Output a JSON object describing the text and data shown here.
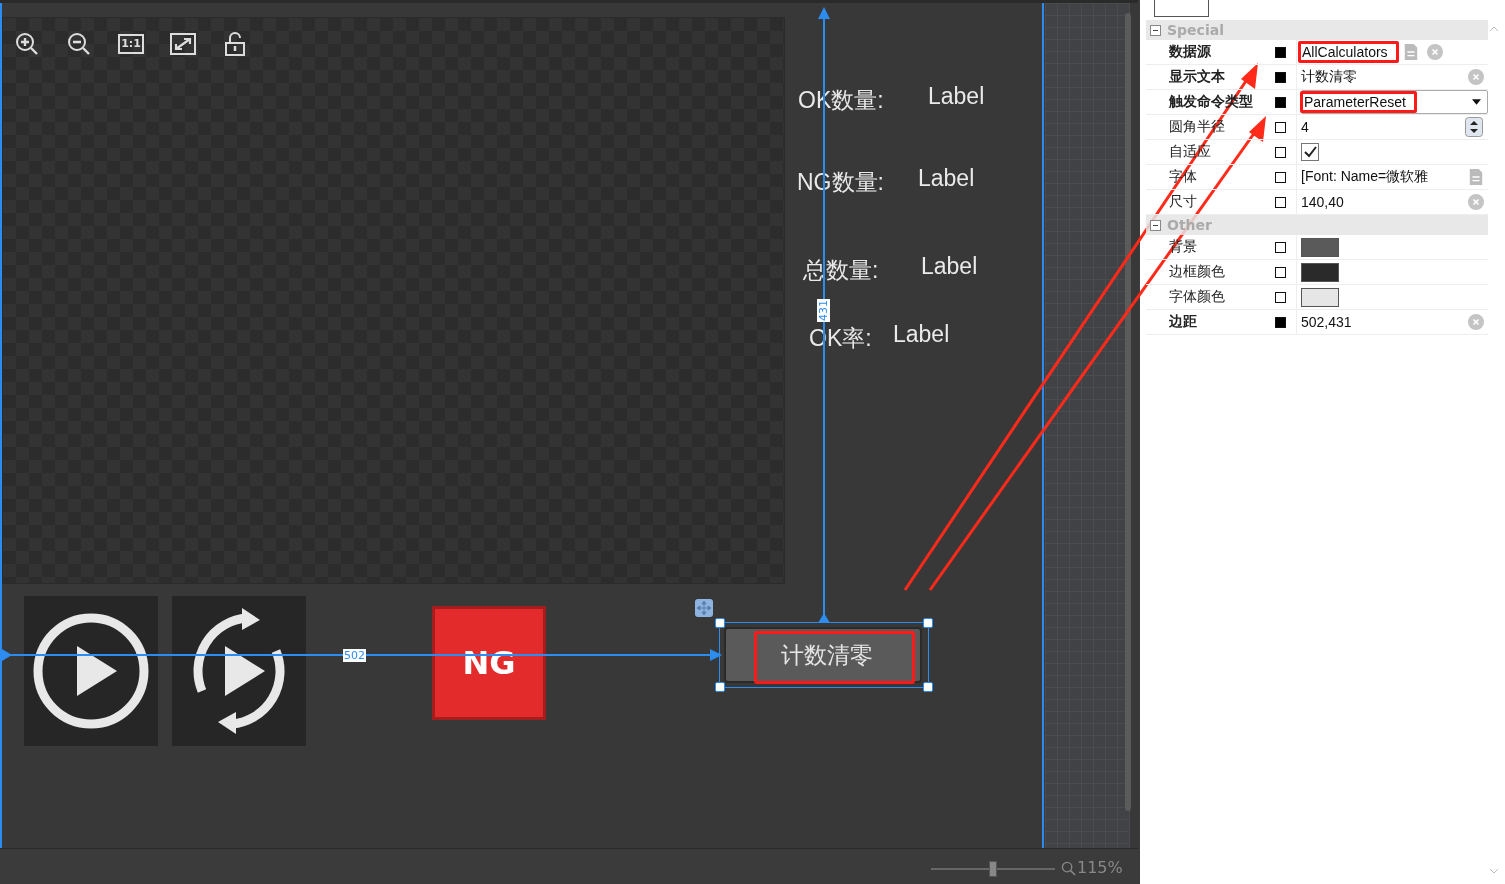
{
  "toolbar": {
    "actual_size_label": "1:1"
  },
  "canvas": {
    "stats": [
      {
        "caption": "OK数量:",
        "value": "Label"
      },
      {
        "caption": "NG数量:",
        "value": "Label"
      },
      {
        "caption": "总数量:",
        "value": "Label"
      },
      {
        "caption": "OK率:",
        "value": "Label"
      }
    ],
    "ng_button": "NG",
    "reset_button": {
      "label": "计数清零",
      "selected": true
    },
    "horizontal_distance": "502",
    "vertical_distance": "431"
  },
  "zoom": {
    "level": 0.5,
    "reading": "115%"
  },
  "properties": {
    "groups": [
      {
        "name": "Special",
        "expanded": true,
        "rows": [
          {
            "name": "数据源",
            "modified": true,
            "kind": "text",
            "value": "AllCalculators",
            "annotated": true,
            "has_editor": true,
            "clearable": true
          },
          {
            "name": "显示文本",
            "modified": true,
            "kind": "text",
            "value": "计数清零",
            "annotated": false,
            "has_editor": false,
            "clearable": true
          },
          {
            "name": "触发命令类型",
            "modified": true,
            "kind": "dropdown",
            "value": "ParameterReset",
            "annotated": true,
            "has_editor": false,
            "clearable": false
          },
          {
            "name": "圆角半径",
            "modified": false,
            "kind": "spinner",
            "value": "4",
            "annotated": false,
            "has_editor": false,
            "clearable": false
          },
          {
            "name": "自适应",
            "modified": false,
            "kind": "checkbox",
            "checked": true,
            "annotated": false,
            "has_editor": false,
            "clearable": false
          },
          {
            "name": "字体",
            "modified": false,
            "kind": "text",
            "value": "[Font: Name=微软雅",
            "annotated": false,
            "has_editor": true,
            "clearable": false
          },
          {
            "name": "尺寸",
            "modified": false,
            "kind": "text",
            "value": "140,40",
            "annotated": false,
            "has_editor": false,
            "clearable": true
          }
        ]
      },
      {
        "name": "Other",
        "expanded": true,
        "rows": [
          {
            "name": "背景",
            "modified": false,
            "kind": "color",
            "color": "#5a5a5a",
            "annotated": false,
            "has_editor": false,
            "clearable": false
          },
          {
            "name": "边框颜色",
            "modified": false,
            "kind": "color",
            "color": "#2a2a2a",
            "annotated": false,
            "has_editor": false,
            "clearable": false
          },
          {
            "name": "字体颜色",
            "modified": false,
            "kind": "color",
            "color": "#e6e6e6",
            "annotated": false,
            "has_editor": false,
            "clearable": false
          },
          {
            "name": "边距",
            "modified": true,
            "kind": "text",
            "value": "502,431",
            "annotated": false,
            "has_editor": false,
            "clearable": true
          }
        ]
      }
    ]
  }
}
